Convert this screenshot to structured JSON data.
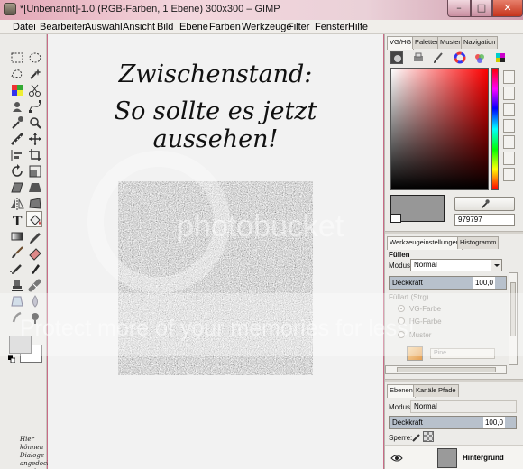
{
  "window": {
    "title": "*[Unbenannt]-1.0 (RGB-Farben, 1 Ebene) 300x300 – GIMP",
    "min_glyph": "–",
    "max_glyph": "□",
    "close_glyph": "✕"
  },
  "menu": [
    "Datei",
    "Bearbeiten",
    "Auswahl",
    "Ansicht",
    "Bild",
    "Ebene",
    "Farben",
    "Werkzeuge",
    "Filter",
    "Fenster",
    "Hilfe"
  ],
  "toolbox": {
    "tools": [
      "rect-select",
      "ellipse-select",
      "free-select",
      "fuzzy-select",
      "color-select",
      "scissors",
      "foreground-select",
      "paths",
      "color-picker",
      "zoom",
      "measure",
      "move",
      "align",
      "crop",
      "rotate",
      "scale",
      "shear",
      "perspective",
      "flip",
      "cage",
      "text",
      "bucket-fill",
      "blend",
      "pencil",
      "paintbrush",
      "eraser",
      "airbrush",
      "ink",
      "clone",
      "heal",
      "perspective-clone",
      "blur",
      "smudge",
      "dodge-burn"
    ],
    "hint": "Hier können Dialoge angedockt werden"
  },
  "canvas": {
    "line1": "Zwischenstand:",
    "line2": "So sollte es jetzt aussehen!"
  },
  "watermark": {
    "text1": "photobucket",
    "text2": "Protect more of your memories for less!"
  },
  "dock": {
    "tabs_top": [
      "VG/HG",
      "Paletten",
      "Muster",
      "Navigation"
    ],
    "color_hex": "979797",
    "tabs_mid": [
      "Werkzeugeinstellungen",
      "Histogramm"
    ],
    "tool_options": {
      "title": "Füllen",
      "mode_label": "Modus:",
      "mode_value": "Normal",
      "opacity_label": "Deckkraft",
      "opacity_value": "100,0",
      "fill_type_label": "Füllart  (Strg)",
      "fill_options": [
        "VG-Farbe",
        "HG-Farbe",
        "Muster"
      ],
      "pattern_name": "Pine"
    },
    "tabs_bottom": [
      "Ebenen",
      "Kanäle",
      "Pfade"
    ],
    "layers": {
      "mode_label": "Modus:",
      "mode_value": "Normal",
      "opacity_label": "Deckkraft",
      "opacity_value": "100,0",
      "lock_label": "Sperre:",
      "layer_name": "Hintergrund"
    }
  },
  "colors": {
    "foreground": "#cfcfcf",
    "background": "#ffffff",
    "current": "#979797"
  }
}
